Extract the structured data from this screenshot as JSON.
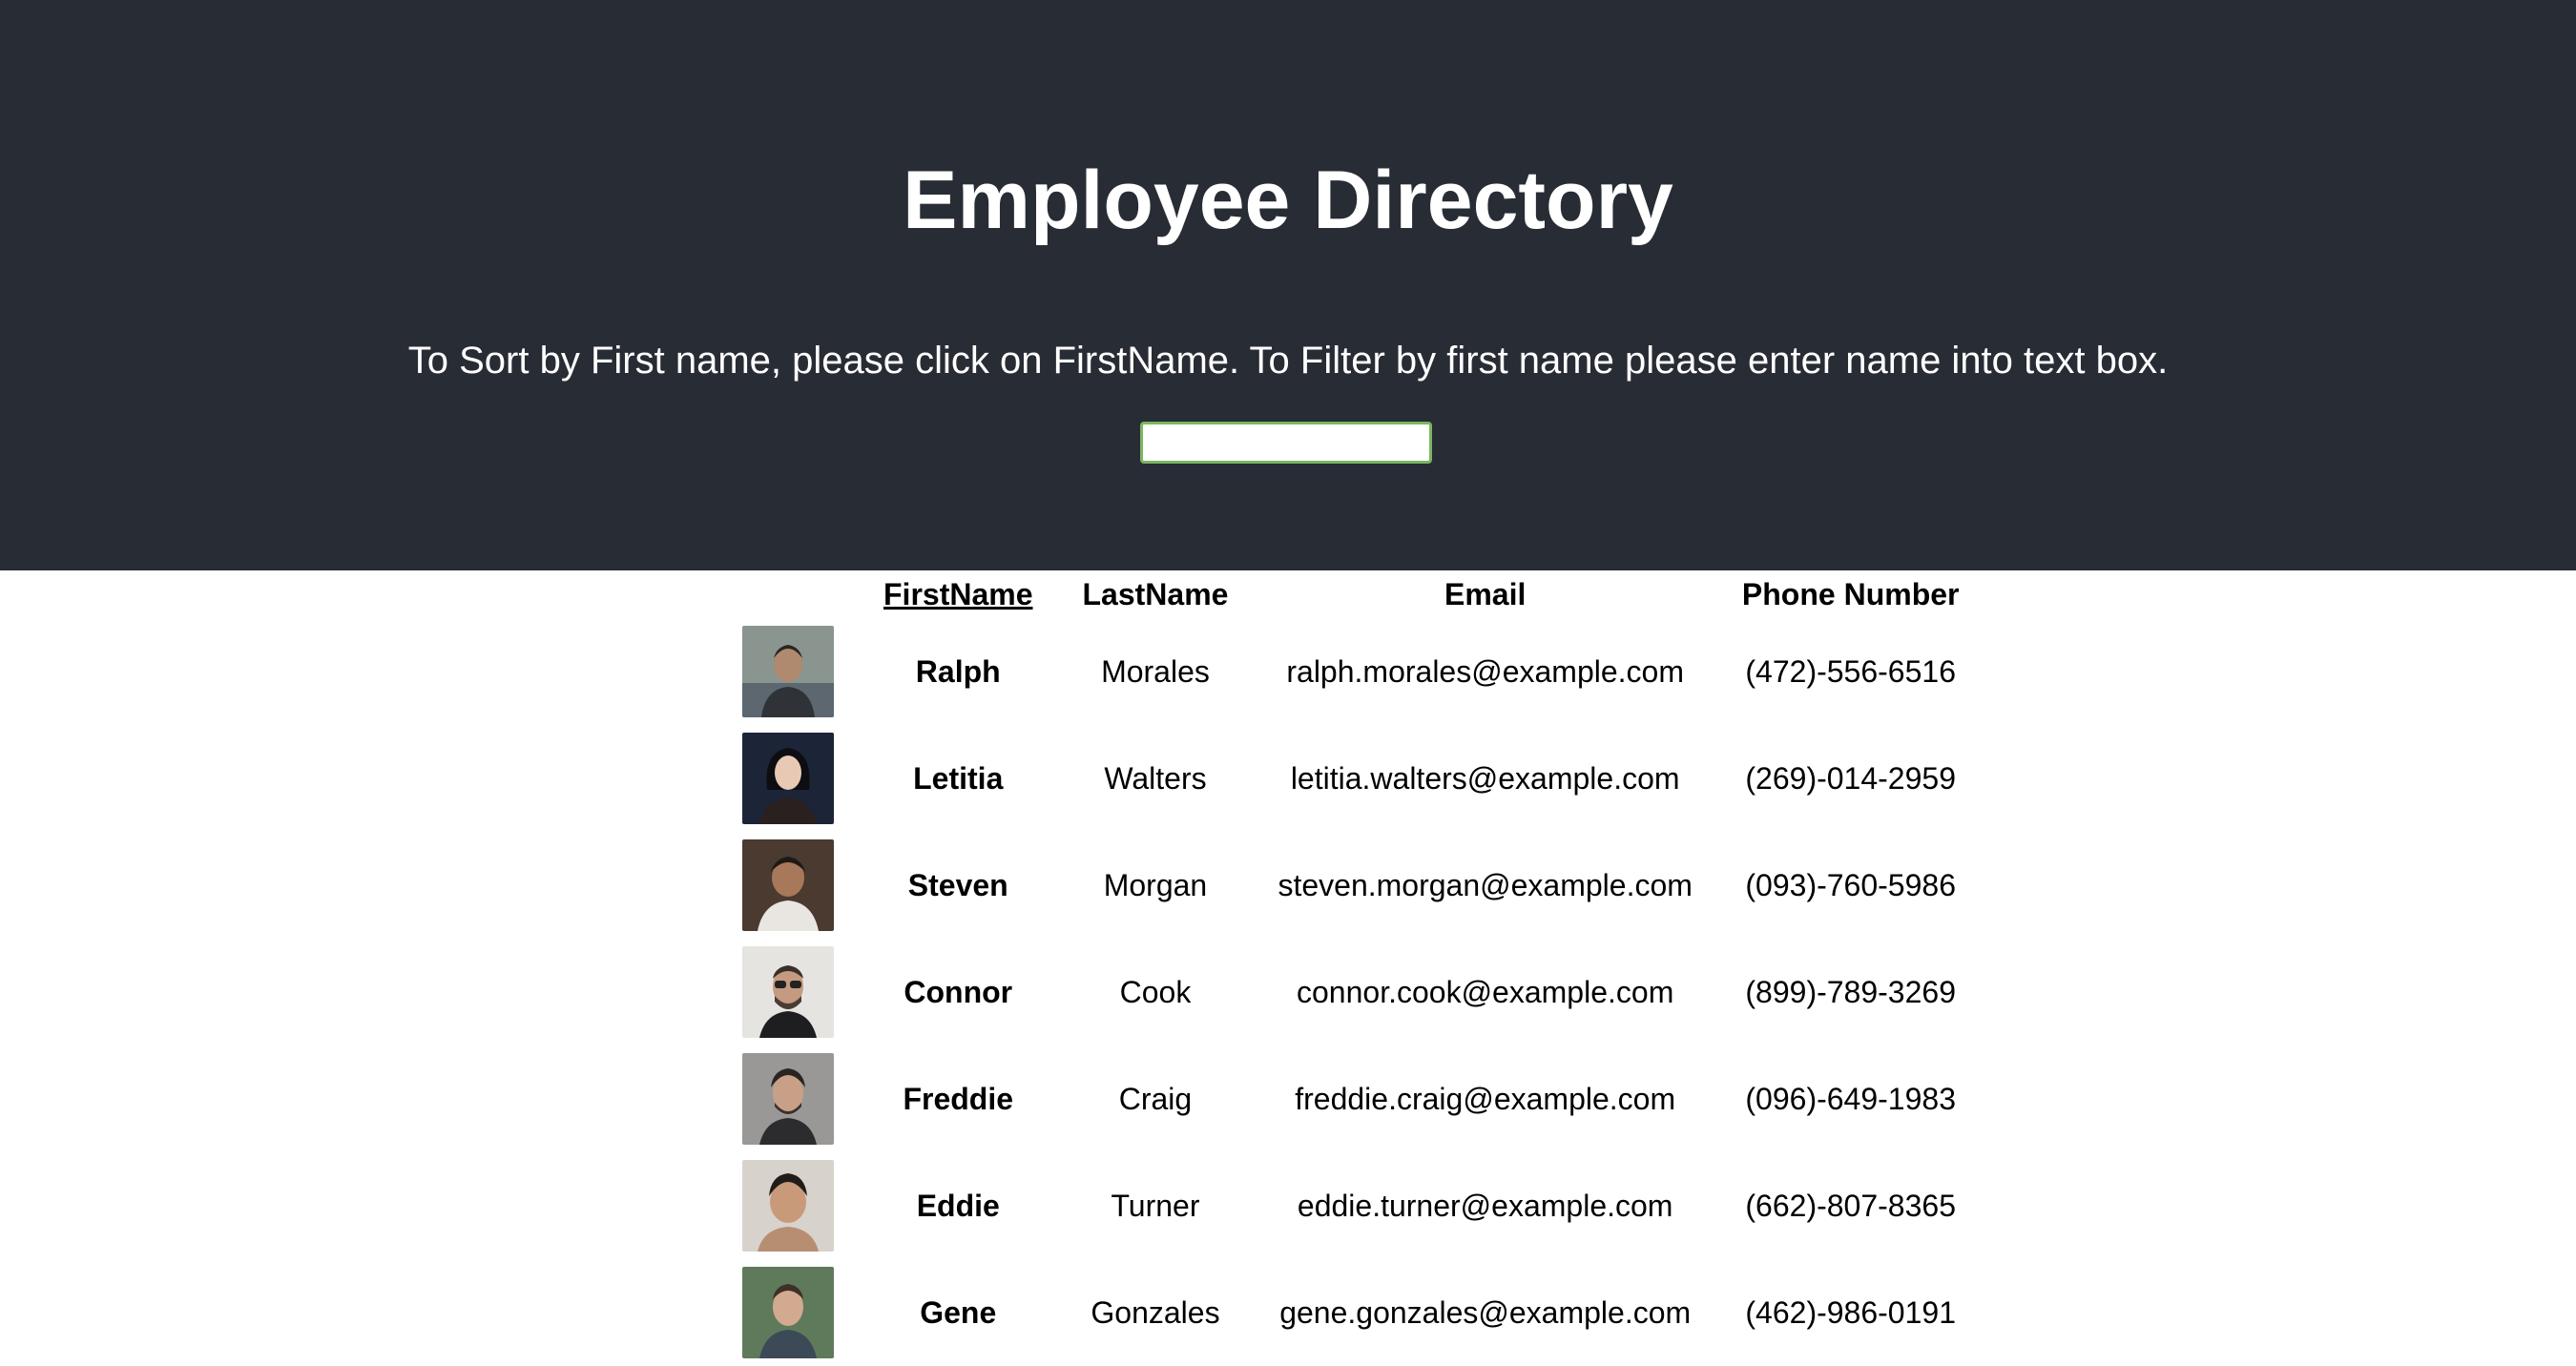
{
  "header": {
    "title": "Employee Directory",
    "instructions": "To Sort by First name, please click on FirstName. To Filter by first name please enter name into text box.",
    "filter_value": "",
    "filter_placeholder": "",
    "background_color": "#282c34",
    "input_border_color": "#7bb661"
  },
  "table": {
    "columns": {
      "photo": "",
      "first_name": "FirstName",
      "last_name": "LastName",
      "email": "Email",
      "phone": "Phone Number"
    },
    "rows": [
      {
        "first": "Ralph",
        "last": "Morales",
        "email": "ralph.morales@example.com",
        "phone": "(472)-556-6516",
        "photo_icon": "employee-photo"
      },
      {
        "first": "Letitia",
        "last": "Walters",
        "email": "letitia.walters@example.com",
        "phone": "(269)-014-2959",
        "photo_icon": "employee-photo"
      },
      {
        "first": "Steven",
        "last": "Morgan",
        "email": "steven.morgan@example.com",
        "phone": "(093)-760-5986",
        "photo_icon": "employee-photo"
      },
      {
        "first": "Connor",
        "last": "Cook",
        "email": "connor.cook@example.com",
        "phone": "(899)-789-3269",
        "photo_icon": "employee-photo"
      },
      {
        "first": "Freddie",
        "last": "Craig",
        "email": "freddie.craig@example.com",
        "phone": "(096)-649-1983",
        "photo_icon": "employee-photo"
      },
      {
        "first": "Eddie",
        "last": "Turner",
        "email": "eddie.turner@example.com",
        "phone": "(662)-807-8365",
        "photo_icon": "employee-photo"
      },
      {
        "first": "Gene",
        "last": "Gonzales",
        "email": "gene.gonzales@example.com",
        "phone": "(462)-986-0191",
        "photo_icon": "employee-photo"
      }
    ]
  }
}
